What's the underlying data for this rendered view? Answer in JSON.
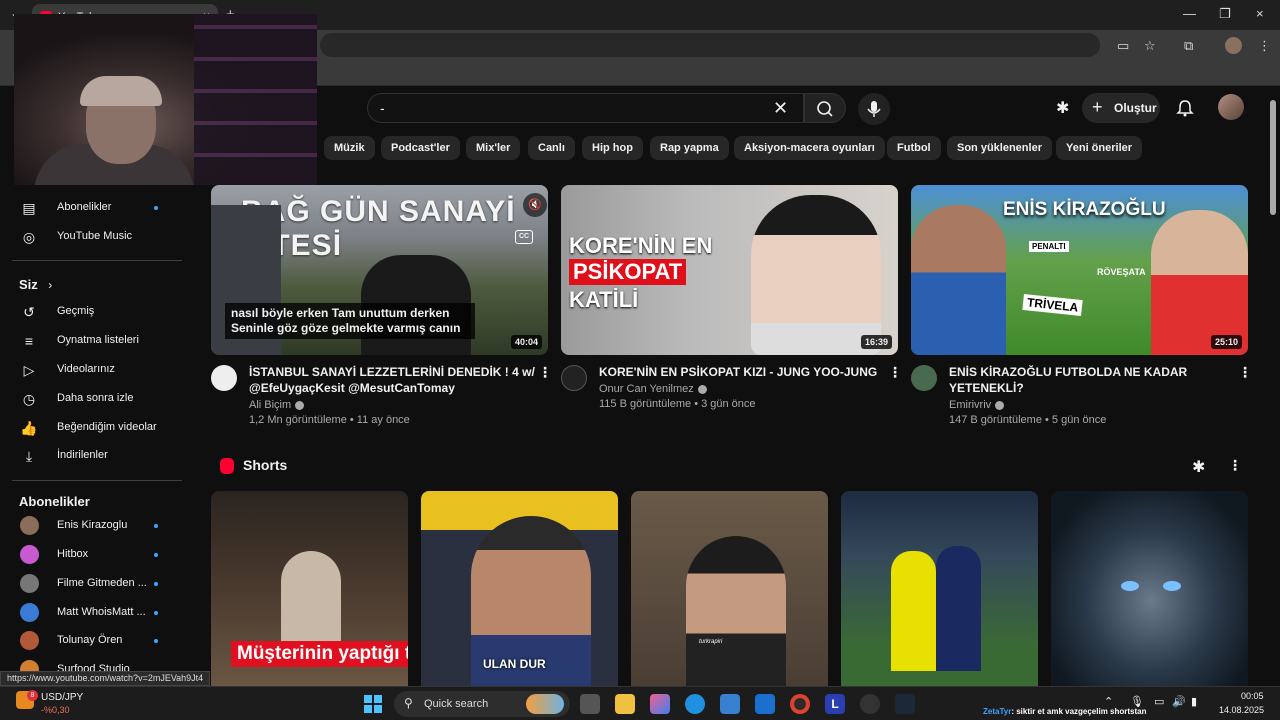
{
  "browser": {
    "tab_title": "YouTube",
    "new_tab_glyph": "+",
    "close_glyph": "×",
    "status_url": "https://www.youtube.com/watch?v=2mJEVah9Jt4"
  },
  "header": {
    "search_value": "-",
    "create_label": "Oluştur"
  },
  "chips": [
    "Müzik",
    "Podcast'ler",
    "Mix'ler",
    "Canlı",
    "Hip hop",
    "Rap yapma",
    "Aksiyon-macera oyunları",
    "Futbol",
    "Son yüklenenler",
    "Yeni öneriler"
  ],
  "sidebar": {
    "top_items": [
      {
        "label": "Abonelikler",
        "icon": "subscriptions-icon",
        "dot": true
      },
      {
        "label": "YouTube Music",
        "icon": "youtube-music-icon",
        "dot": false
      }
    ],
    "you_heading": "Siz",
    "you_items": [
      {
        "label": "Geçmiş",
        "icon": "history-icon"
      },
      {
        "label": "Oynatma listeleri",
        "icon": "playlists-icon"
      },
      {
        "label": "Videolarınız",
        "icon": "your-videos-icon"
      },
      {
        "label": "Daha sonra izle",
        "icon": "watch-later-icon"
      },
      {
        "label": "Beğendiğim videolar",
        "icon": "liked-videos-icon"
      },
      {
        "label": "İndirilenler",
        "icon": "downloads-icon"
      }
    ],
    "subs_heading": "Abonelikler",
    "subscriptions": [
      {
        "label": "Enis Kirazoglu",
        "dot": true,
        "color": "#8a6d5a"
      },
      {
        "label": "Hitbox",
        "dot": true,
        "color": "#c85ad0"
      },
      {
        "label": "Filme Gitmeden ...",
        "dot": true,
        "color": "#777777"
      },
      {
        "label": "Matt WhoisMatt ...",
        "dot": true,
        "color": "#3a7bd5"
      },
      {
        "label": "Tolunay Ören",
        "dot": true,
        "color": "#b05a3a"
      },
      {
        "label": "Surfood Studio",
        "dot": false,
        "color": "#d08030"
      }
    ]
  },
  "videos": [
    {
      "title": "İSTANBUL SANAYİ LEZZETLERİNİ DENEDİK ! 4 w/ @EfeUygaçKesit @MesutCanTomay",
      "channel": "Ali Biçim",
      "meta": "1,2 Mn görüntüleme • 11 ay önce",
      "duration": "40:04",
      "thumb_text": "BAĞ GÜN SANAYİ SİTESİ",
      "caption": "nasıl böyle erken Tam unuttum derken Seninle göz göze gelmekte varmış canın"
    },
    {
      "title": "KORE'NİN EN PSİKOPAT KIZI - JUNG YOO-JUNG",
      "channel": "Onur Can Yenilmez",
      "meta": "115 B görüntüleme • 3 gün önce",
      "duration": "16:39",
      "thumb_line1": "KORE'NİN EN",
      "thumb_line2": "PSİKOPAT",
      "thumb_line3": "KATİLİ"
    },
    {
      "title": "ENİS KİRAZOĞLU FUTBOLDA NE KADAR YETENEKLİ?",
      "channel": "Emirivriv",
      "meta": "147 B görüntüleme • 5 gün önce",
      "duration": "25:10",
      "thumb_text": "ENİS KİRAZOĞLU",
      "thumb_tags": [
        "PENALTI",
        "RÖVEŞATA",
        "TRİVELA"
      ]
    }
  ],
  "shorts": {
    "heading": "Shorts",
    "items": [
      {
        "overlay": "Müşterinin yaptığı teklife"
      },
      {
        "overlay": "ULAN DUR"
      },
      {
        "overlay": "turkrapiri"
      },
      {
        "overlay": ""
      },
      {
        "overlay": ""
      }
    ]
  },
  "taskbar": {
    "ticker_name": "USD/JPY",
    "ticker_change": "-%0,30",
    "ticker_badge": "8",
    "search_label": "Quick search",
    "notice_user": "ZetaTyr",
    "notice_text": ": siktir et amk vazgeçelim shortstan",
    "time": "00:05",
    "date": "14.08.2025"
  },
  "colors": {
    "accent_blue": "#3ea6ff",
    "youtube_red": "#ff0033",
    "background": "#0f0f0f"
  }
}
